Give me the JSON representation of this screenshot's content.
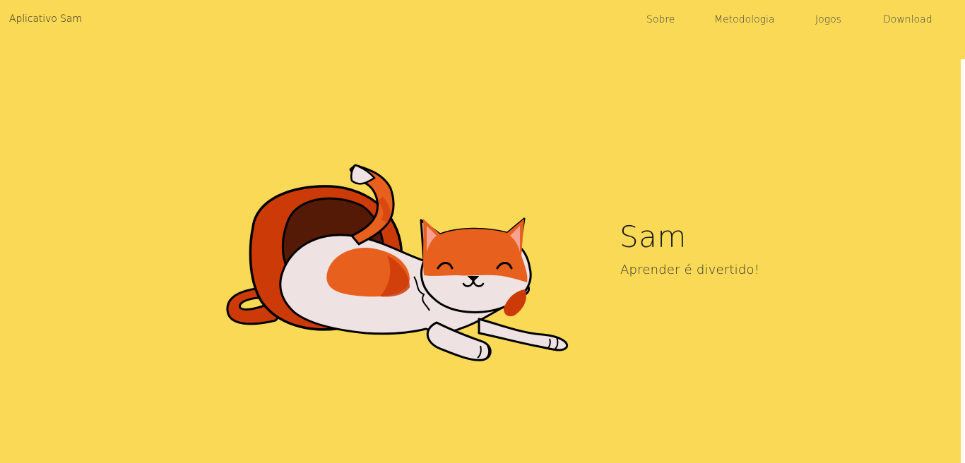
{
  "header": {
    "brand": "Aplicativo Sam",
    "nav": [
      "Sobre",
      "Metodologia",
      "Jogos",
      "Download"
    ]
  },
  "hero": {
    "title": "Sam",
    "subtitle": "Aprender é divertido!",
    "illustration": "cat-in-bag-illustration"
  },
  "colors": {
    "background": "#f9d955",
    "cat_orange": "#e8601e",
    "bag_red": "#cc3a08",
    "bag_inside": "#541a05"
  }
}
